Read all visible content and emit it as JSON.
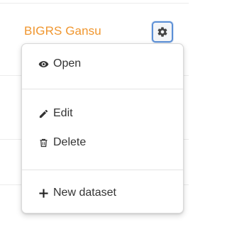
{
  "dataset": {
    "title": "BIGRS Gansu",
    "title_color": "#f0962e"
  },
  "settings_button": {
    "icon": "gear-icon",
    "border_color": "#5b8fd6"
  },
  "menu": {
    "items": [
      {
        "label": "Open",
        "icon": "eye-icon"
      },
      {
        "label": "Edit",
        "icon": "pencil-icon"
      },
      {
        "label": "Delete",
        "icon": "trash-icon"
      },
      {
        "label": "New dataset",
        "icon": "plus-icon"
      }
    ]
  }
}
